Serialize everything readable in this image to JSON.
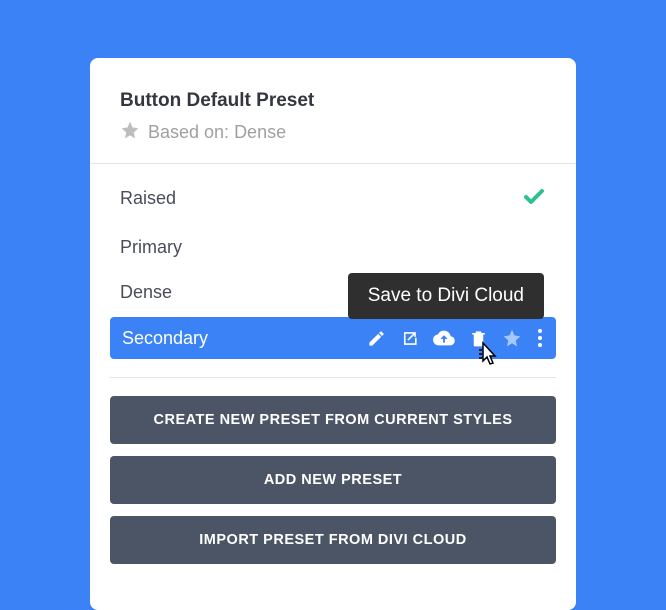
{
  "header": {
    "title": "Button Default Preset",
    "based_on_label": "Based on: Dense"
  },
  "presets": [
    {
      "name": "Raised",
      "checked": true,
      "active": false
    },
    {
      "name": "Primary",
      "checked": false,
      "active": false
    },
    {
      "name": "Dense",
      "checked": false,
      "active": false
    },
    {
      "name": "Secondary",
      "checked": false,
      "active": true
    }
  ],
  "tooltip": "Save to Divi Cloud",
  "buttons": {
    "create": "CREATE NEW PRESET FROM CURRENT STYLES",
    "add": "ADD NEW PRESET",
    "import": "IMPORT PRESET FROM DIVI CLOUD"
  },
  "icons": {
    "star": "star-icon",
    "check": "check-icon",
    "edit": "edit-icon",
    "export": "export-icon",
    "cloud_upload": "cloud-upload-icon",
    "delete": "delete-icon",
    "favorite": "star-icon",
    "more": "more-icon"
  },
  "colors": {
    "accent": "#3b82f6",
    "button_bg": "#4c5566",
    "tooltip_bg": "#2f2f2f",
    "check": "#2bc190"
  }
}
